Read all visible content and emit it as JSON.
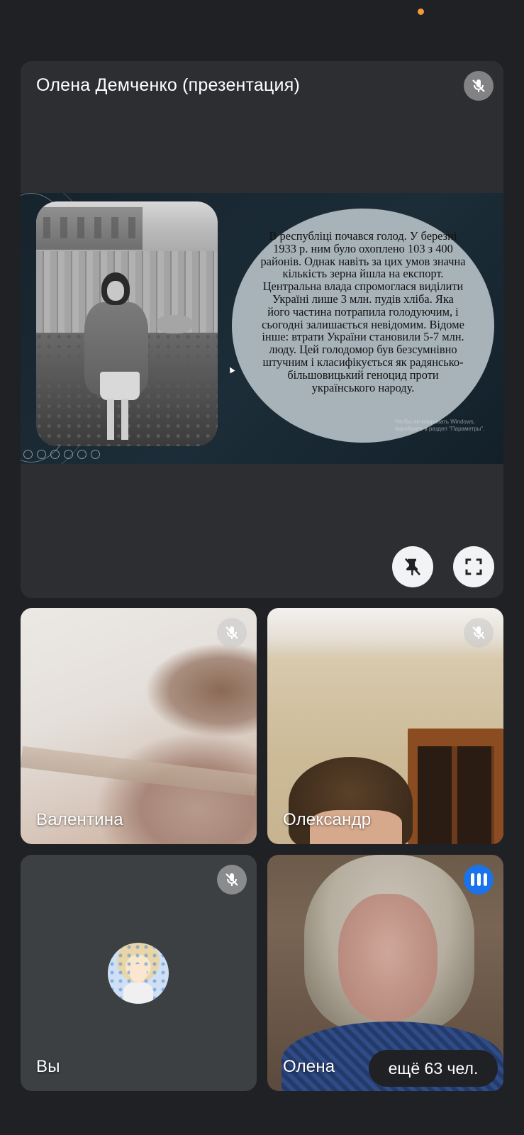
{
  "presentation": {
    "presenter_label": "Олена Демченко (презентация)",
    "slide_text": "В республіці почався голод. У березні 1933 р. ним було охоплено 103 з 400 районів. Однак навіть за цих умов значна кількість зерна йшла на експорт. Центральна влада спромоглася виділити Україні лише 3 млн. пудів хліба. Яка його частина потрапила голодуючим, і сьогодні залишається невідомим. Відоме інше: втрати України становили 5-7 млн. люду. Цей голодомор був безсумнівно штучним і класифікується як радянсько-більшовицький геноцид проти українського народу.",
    "watermark_text": "Чтобы активировать Windows, перейдите в раздел \"Параметры\".",
    "controls": {
      "unpin_icon": "unpin-icon",
      "fullscreen_icon": "fullscreen-icon"
    }
  },
  "participants": [
    {
      "name": "Валентина",
      "muted": true
    },
    {
      "name": "Олександр",
      "muted": true
    },
    {
      "name": "Вы",
      "muted": true
    },
    {
      "name": "Олена",
      "speaking": true
    }
  ],
  "more_participants": "ещё 63 чел.",
  "colors": {
    "background": "#202124",
    "tile": "#3c4043",
    "speaking_accent": "#1a73e8",
    "status_dot": "#f29a38"
  }
}
